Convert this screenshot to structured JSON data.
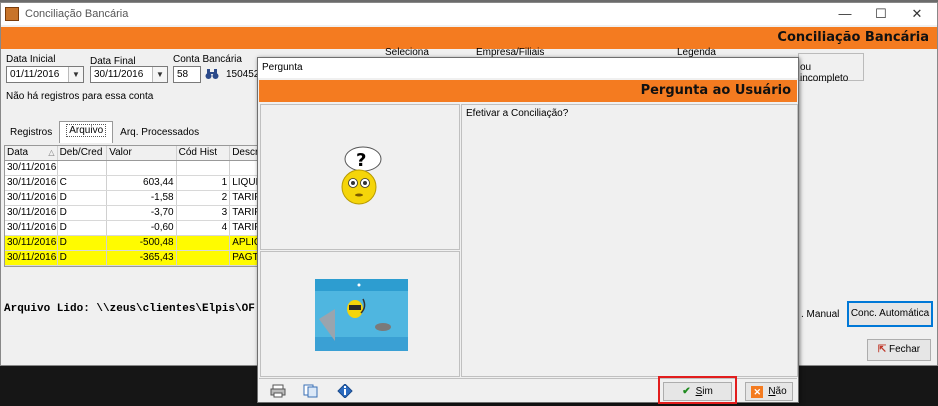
{
  "window": {
    "title": "Conciliação Bancária",
    "header_label": "Conciliação Bancária",
    "minimize_glyph": "—",
    "maximize_glyph": "☐",
    "close_glyph": "✕"
  },
  "filters": {
    "data_inicial_label": "Data Inicial",
    "data_inicial_value": "01/11/2016",
    "data_final_label": "Data Final",
    "data_final_value": "30/11/2016",
    "conta_bancaria_label": "Conta Bancária",
    "conta_bancaria_value": "58",
    "conta_extra": "150452",
    "seleciona_label": "Seleciona",
    "empresa_label": "Empresa/Filiais",
    "legenda_label": "Legenda",
    "legenda_value": "ou incompleto"
  },
  "status_message": "Não há registros para essa conta",
  "tabs": [
    {
      "label": "Registros"
    },
    {
      "label": "Arquivo"
    },
    {
      "label": "Arq. Processados"
    }
  ],
  "grid": {
    "columns": [
      "Data",
      "Deb/Cred",
      "Valor",
      "Cód Hist",
      "Descri"
    ],
    "rows": [
      {
        "data": "30/11/2016",
        "dc": "",
        "valor": "",
        "hist": "",
        "desc": ""
      },
      {
        "data": "30/11/2016",
        "dc": "C",
        "valor": "603,44",
        "hist": "1",
        "desc": "LIQUID"
      },
      {
        "data": "30/11/2016",
        "dc": "D",
        "valor": "-1,58",
        "hist": "2",
        "desc": "TARIF"
      },
      {
        "data": "30/11/2016",
        "dc": "D",
        "valor": "-3,70",
        "hist": "3",
        "desc": "TARIF"
      },
      {
        "data": "30/11/2016",
        "dc": "D",
        "valor": "-0,60",
        "hist": "4",
        "desc": "TARIF"
      },
      {
        "data": "30/11/2016",
        "dc": "D",
        "valor": "-500,48",
        "hist": "",
        "desc": "APLICA"
      },
      {
        "data": "30/11/2016",
        "dc": "D",
        "valor": "-365,43",
        "hist": "",
        "desc": "PAGTO"
      }
    ]
  },
  "file_read": "Arquivo Lido: \\\\zeus\\clientes\\Elpis\\OF",
  "buttons": {
    "manual": ". Manual",
    "automatica": "Conc. Automática",
    "fechar": "Fechar"
  },
  "dialog": {
    "title": "Pergunta",
    "header_label": "Pergunta ao Usuário",
    "question": "Efetivar a Conciliação?",
    "sim": "Sim",
    "nao": "Não"
  },
  "colors": {
    "accent_orange": "#f47b20",
    "highlight_yellow": "#fffb00",
    "focus_blue": "#0078d7",
    "red_outline": "#e21d1d"
  }
}
